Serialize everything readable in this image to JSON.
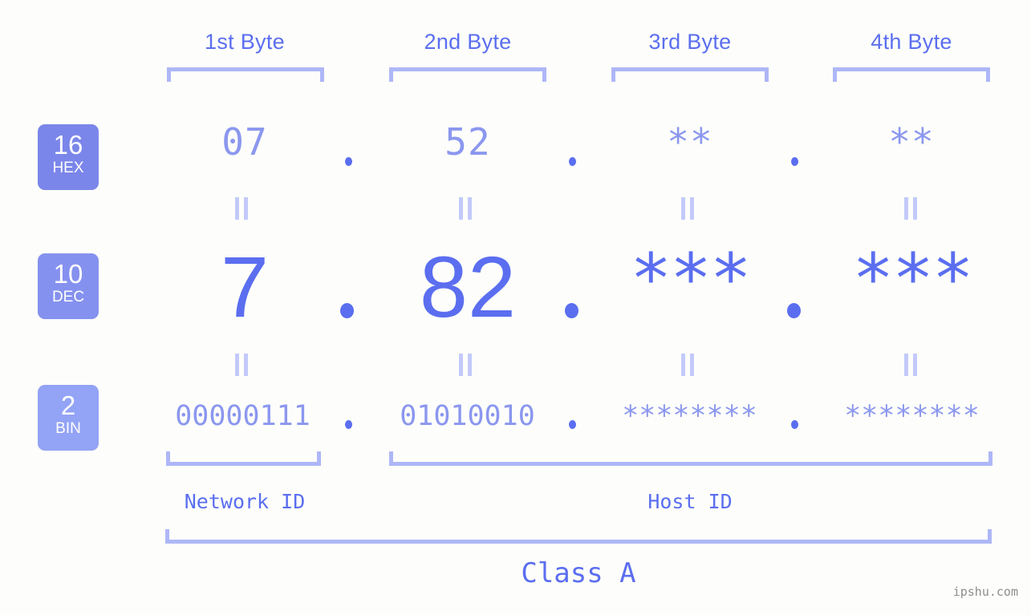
{
  "byte_headers": [
    {
      "label": "1st Byte"
    },
    {
      "label": "2nd Byte"
    },
    {
      "label": "3rd Byte"
    },
    {
      "label": "4th Byte"
    }
  ],
  "rows": [
    {
      "badge_number": "16",
      "badge_label": "HEX",
      "values": [
        "07",
        "52",
        "**",
        "**"
      ]
    },
    {
      "badge_number": "10",
      "badge_label": "DEC",
      "values": [
        "7",
        "82",
        "***",
        "***"
      ]
    },
    {
      "badge_number": "2",
      "badge_label": "BIN",
      "values": [
        "00000111",
        "01010010",
        "********",
        "********"
      ]
    }
  ],
  "separator": ".",
  "segments": {
    "network_id": "Network ID",
    "host_id": "Host ID"
  },
  "class_label": "Class A",
  "watermark": "ipshu.com",
  "colors": {
    "background": "#fdfefb",
    "accent_strong": "#5b6ef0",
    "accent_mid": "#8b97ef",
    "accent_light": "#aeb7f7",
    "badge_hex": "#7b86ea",
    "badge_dec": "#8591ef",
    "badge_bin": "#93a3f5",
    "watermark": "#8d8d8d"
  }
}
